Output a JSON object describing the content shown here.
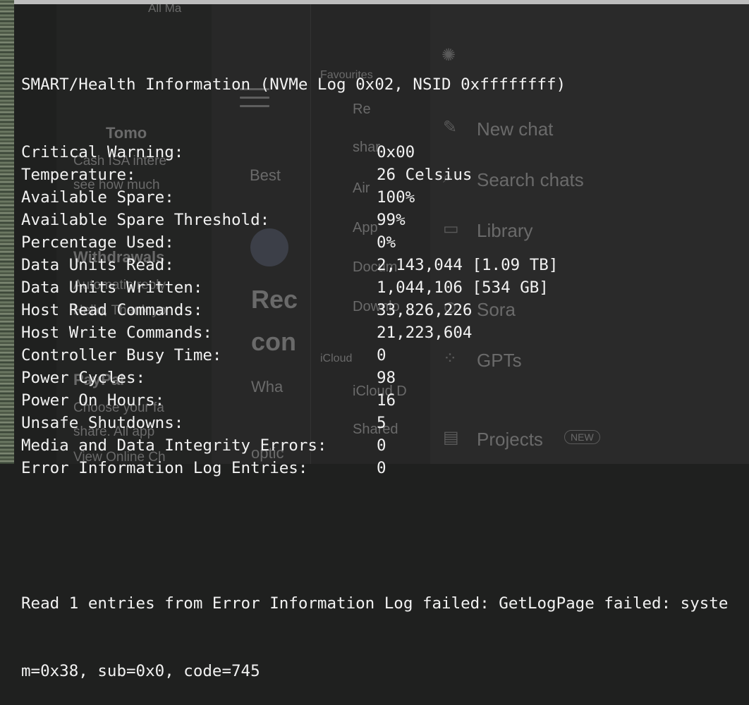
{
  "terminal": {
    "header": "SMART/Health Information (NVMe Log 0x02, NSID 0xffffffff)",
    "rows": [
      {
        "label": "Critical Warning:",
        "value": "0x00"
      },
      {
        "label": "Temperature:",
        "value": "26 Celsius"
      },
      {
        "label": "Available Spare:",
        "value": "100%"
      },
      {
        "label": "Available Spare Threshold:",
        "value": "99%"
      },
      {
        "label": "Percentage Used:",
        "value": "0%"
      },
      {
        "label": "Data Units Read:",
        "value": "2,143,044 [1.09 TB]"
      },
      {
        "label": "Data Units Written:",
        "value": "1,044,106 [534 GB]"
      },
      {
        "label": "Host Read Commands:",
        "value": "33,826,226"
      },
      {
        "label": "Host Write Commands:",
        "value": "21,223,604"
      },
      {
        "label": "Controller Busy Time:",
        "value": "0"
      },
      {
        "label": "Power Cycles:",
        "value": "98"
      },
      {
        "label": "Power On Hours:",
        "value": "16"
      },
      {
        "label": "Unsafe Shutdowns:",
        "value": "5"
      },
      {
        "label": "Media and Data Integrity Errors:",
        "value": "0"
      },
      {
        "label": "Error Information Log Entries:",
        "value": "0"
      }
    ],
    "error_line_1": "Read 1 entries from Error Information Log failed: GetLogPage failed: syste",
    "error_line_2": "m=0x38, sub=0x0, code=745"
  },
  "background": {
    "mail": {
      "all_mail": "All Ma",
      "cash_isa": "Cash ISA intere",
      "see_how": "see how much",
      "withdrawals": "Withdrawals",
      "auto_reply": "Automatic reply",
      "hello": "Hello, Thank yo",
      "paypal": "PayPal",
      "choose": "Choose your fa",
      "share": "share. All app",
      "view_online": "View Online Ch",
      "tomo": "Tomo"
    },
    "browser": {
      "best": "Best",
      "rec": "Rec",
      "con": "con",
      "wha": "Wha",
      "optic": "optic"
    },
    "finder": {
      "favourites": "Favourites",
      "recents": "Re",
      "shared": "shar",
      "airdrop": "Air",
      "applications": "App",
      "documents": "Docum",
      "downloads": "Downlo",
      "icloud_section": "iCloud",
      "icloud_drive": "iCloud D",
      "shared_item": "Shared"
    },
    "chatgpt": {
      "new_chat": "New chat",
      "search_chats": "Search chats",
      "library": "Library",
      "sora": "Sora",
      "gpts": "GPTs",
      "projects": "Projects",
      "new_badge": "NEW"
    },
    "icons": [
      "openai-logo-icon",
      "edit-icon",
      "search-icon",
      "library-icon",
      "play-icon",
      "grid-icon",
      "folder-icon",
      "hamburger-menu-icon",
      "apple-logo-icon"
    ]
  }
}
